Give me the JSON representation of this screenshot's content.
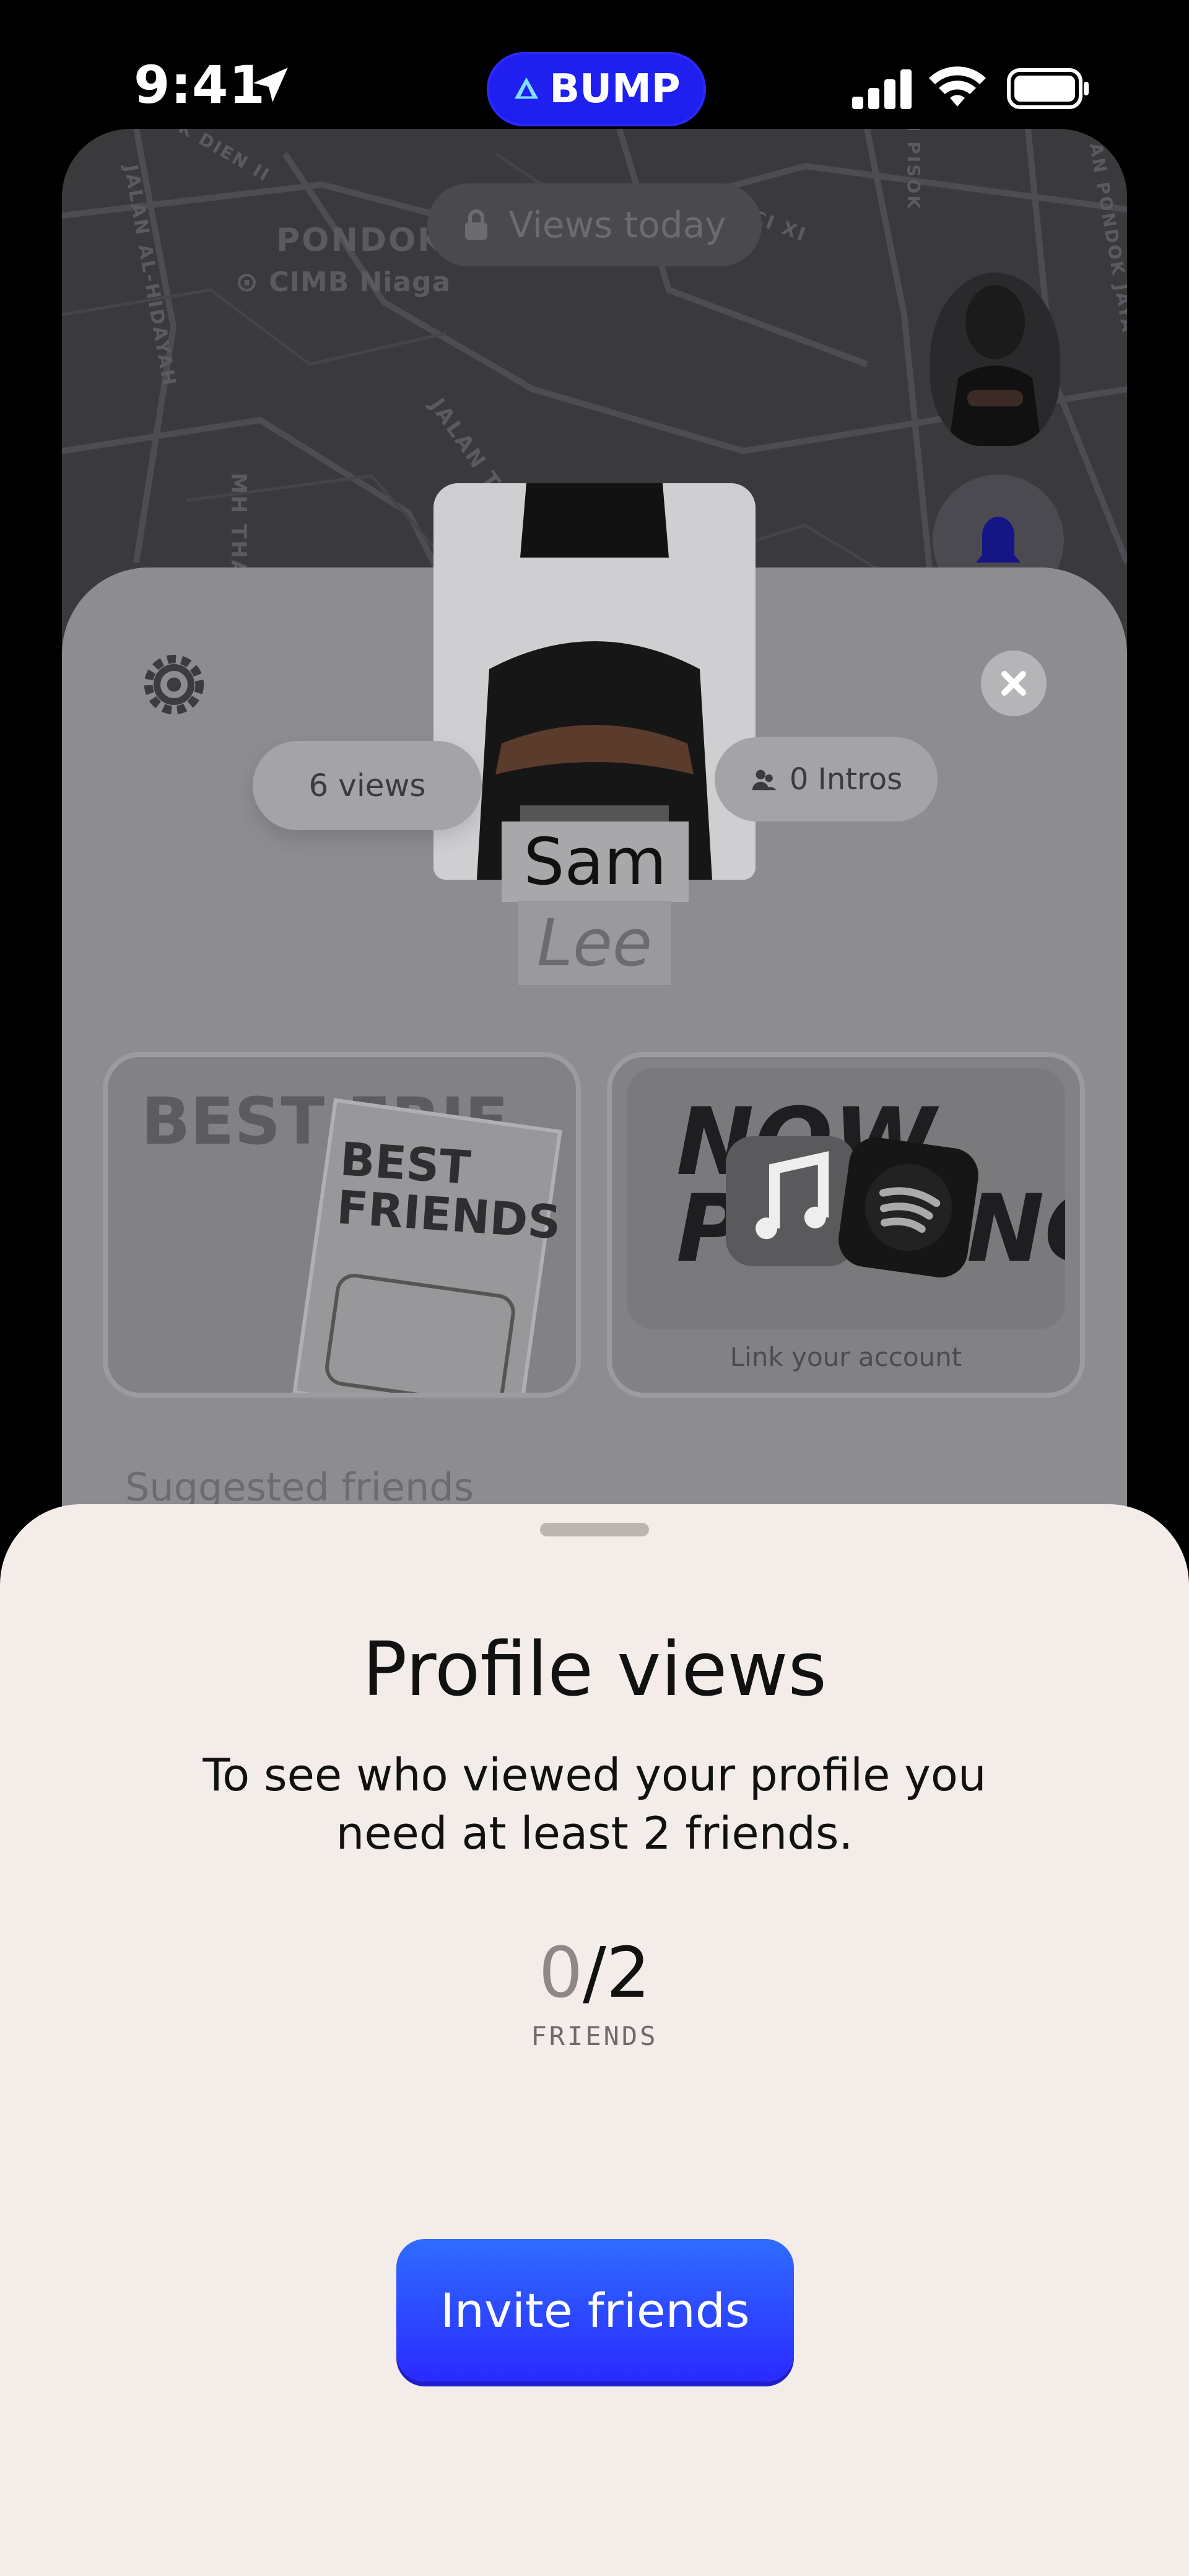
{
  "status_bar": {
    "time": "9:41",
    "app_badge": "BUMP"
  },
  "map": {
    "labels": [
      "PONDOK RANJI",
      "CIMB Niaga",
      "JALAN AL-HIDAYAH",
      "PERKICI XI",
      "JALAN TE",
      "MH THA",
      "AN PONDOK JAYA",
      "N PISOK",
      "K DIEN II"
    ],
    "views_today": "Views today"
  },
  "profile": {
    "views": "6 views",
    "intros": "0 Intros",
    "first_name": "Sam",
    "last_name": "Lee",
    "best_friends_tile": {
      "text_big": "BEST FRIENDS",
      "text_small": "BEST FRIE"
    },
    "now_playing_tile": {
      "text": "NOW PLAYING",
      "caption": "Link your account"
    },
    "suggested_heading": "Suggested friends"
  },
  "sheet": {
    "title": "Profile views",
    "body": "To see who viewed your profile you need at least 2 friends.",
    "count_current": "0",
    "count_total": "/2",
    "count_label": "FRIENDS",
    "invite_label": "Invite friends"
  },
  "colors": {
    "accent": "#2a2aff",
    "sheet_bg": "#f4ece8",
    "badge_bg": "#1f1ff0"
  },
  "icons": [
    "location-arrow-icon",
    "signal-icon",
    "wifi-icon",
    "battery-icon",
    "lock-icon",
    "bell-icon",
    "gear-icon",
    "close-icon",
    "intros-icon",
    "apple-music-icon",
    "spotify-icon"
  ]
}
